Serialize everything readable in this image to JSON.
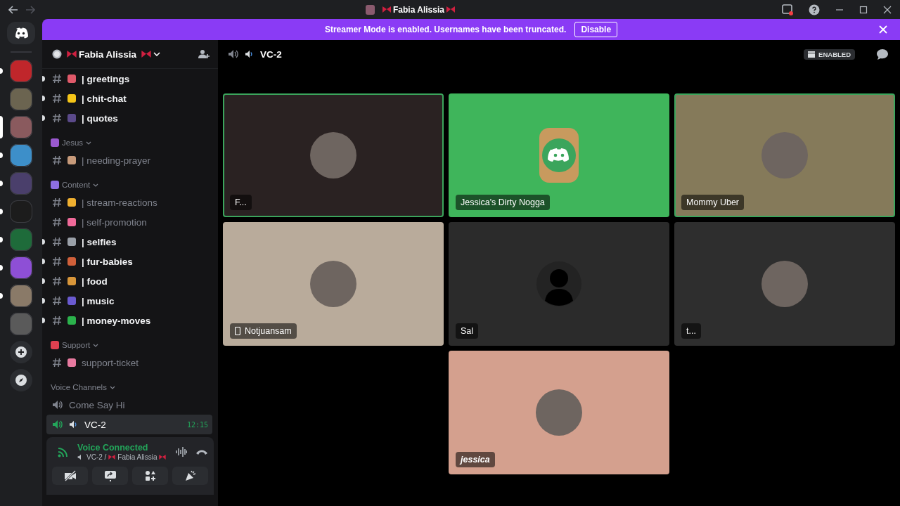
{
  "window": {
    "title": "Fabia Alissia"
  },
  "banner": {
    "message": "Streamer Mode is enabled. Usernames have been truncated.",
    "button": "Disable"
  },
  "servers": [
    {
      "selected": false,
      "unread": true,
      "color": "#c0262b"
    },
    {
      "selected": false,
      "unread": false,
      "color": "#6b6450"
    },
    {
      "selected": true,
      "unread": false,
      "color": "#8a5a5e"
    },
    {
      "selected": false,
      "unread": true,
      "color": "#3d8fc9"
    },
    {
      "selected": false,
      "unread": true,
      "color": "#4a3f6b"
    },
    {
      "selected": false,
      "unread": true,
      "color": "#1c1c1c"
    },
    {
      "selected": false,
      "unread": true,
      "color": "#1e6b3a"
    },
    {
      "selected": false,
      "unread": true,
      "color": "#8e4fd6"
    },
    {
      "selected": false,
      "unread": true,
      "color": "#8a7a68"
    },
    {
      "selected": false,
      "unread": false,
      "color": "#5a5a5a"
    }
  ],
  "server_header": {
    "name": "Fabia Alissia"
  },
  "channels": [
    {
      "kind": "text",
      "name": "| greetings",
      "unread": true,
      "color": "#e05a6a"
    },
    {
      "kind": "text",
      "name": "| chit-chat",
      "unread": true,
      "color": "#f5c518"
    },
    {
      "kind": "text",
      "name": "| quotes",
      "unread": true,
      "color": "#5b4a8a"
    },
    {
      "kind": "category",
      "name": "Jesus",
      "color": "#9b59d0"
    },
    {
      "kind": "text",
      "name": "| needing-prayer",
      "unread": false,
      "color": "#c79a7a"
    },
    {
      "kind": "category",
      "name": "Content",
      "color": "#8e6fe0"
    },
    {
      "kind": "text",
      "name": "| stream-reactions",
      "unread": false,
      "color": "#f0b030"
    },
    {
      "kind": "text",
      "name": "| self-promotion",
      "unread": false,
      "color": "#f06a9a"
    },
    {
      "kind": "text",
      "name": "| selfies",
      "unread": true,
      "color": "#9aa0a8"
    },
    {
      "kind": "text",
      "name": "| fur-babies",
      "unread": true,
      "color": "#d0603a"
    },
    {
      "kind": "text",
      "name": "| food",
      "unread": true,
      "color": "#d8963a"
    },
    {
      "kind": "text",
      "name": "| music",
      "unread": true,
      "color": "#6a5ad0"
    },
    {
      "kind": "text",
      "name": "| money-moves",
      "unread": true,
      "color": "#2bb24c"
    },
    {
      "kind": "category",
      "name": "Support",
      "color": "#e04050"
    },
    {
      "kind": "text",
      "name": "support-ticket",
      "unread": false,
      "color": "#e87aa0"
    },
    {
      "kind": "category",
      "name": "Voice Channels"
    },
    {
      "kind": "voice",
      "name": "Come Say Hi",
      "selected": false
    },
    {
      "kind": "voice",
      "name": "VC-2",
      "selected": true,
      "timer": "12:15"
    }
  ],
  "voice_panel": {
    "status": "Voice Connected",
    "channel": "VC-2 /",
    "server": "Fabia Alissia"
  },
  "call_header": {
    "channel": "VC-2",
    "badge": "ENABLED"
  },
  "tiles": [
    {
      "name": "F...",
      "speaking": true,
      "color": "#2a2222",
      "kind": "photo",
      "mobile": false,
      "italic": false
    },
    {
      "name": "Jessica's Dirty Nogga",
      "speaking": false,
      "color": "#3fb55b",
      "kind": "logo",
      "mobile": false,
      "italic": false
    },
    {
      "name": "Mommy Uber",
      "speaking": true,
      "color": "#857a5a",
      "kind": "photo",
      "mobile": false,
      "italic": false
    },
    {
      "name": "Notjuansam",
      "speaking": false,
      "color": "#b9ab9b",
      "kind": "photo",
      "mobile": true,
      "italic": false
    },
    {
      "name": "Sal",
      "speaking": false,
      "color": "#2b2b2b",
      "kind": "silhouette",
      "mobile": false,
      "italic": false
    },
    {
      "name": "t...",
      "speaking": false,
      "color": "#2e2e2e",
      "kind": "photo",
      "mobile": false,
      "italic": false
    },
    {
      "name": "jessica",
      "speaking": false,
      "color": "#d4a08e",
      "kind": "photo",
      "mobile": false,
      "italic": true
    }
  ]
}
